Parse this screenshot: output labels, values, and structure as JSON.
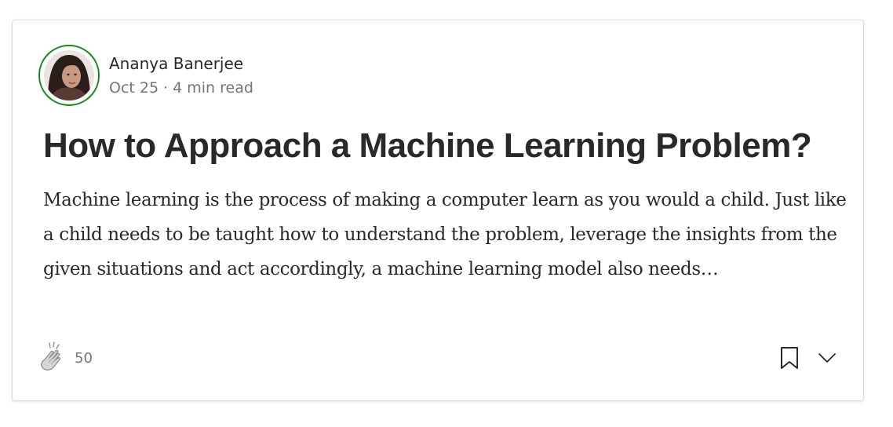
{
  "post": {
    "author_name": "Ananya Banerjee",
    "date": "Oct 25",
    "separator": "·",
    "read_time": "4 min read",
    "title": "How to Approach a Machine Learning Problem?",
    "excerpt": "Machine learning is the process of making a computer learn as you would a child. Just like a child needs to be taught how to understand the problem, leverage the insights from the given situations and act accordingly, a machine learning model also needs…",
    "clap_count": "50"
  },
  "icons": {
    "clap": "clap-icon",
    "bookmark": "bookmark-icon",
    "more": "chevron-down-icon"
  },
  "colors": {
    "avatar_ring": "#1a8917",
    "text_primary": "#292929",
    "text_secondary": "#757575"
  }
}
